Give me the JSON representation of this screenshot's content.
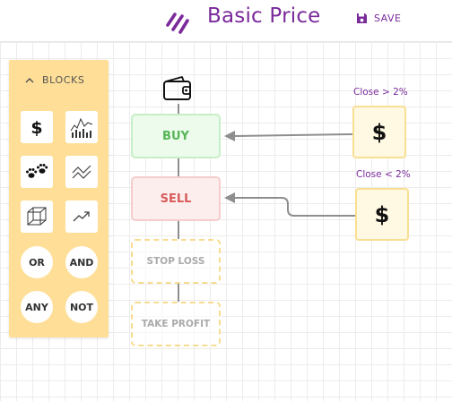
{
  "header": {
    "title": "Basic Price",
    "save_label": "SAVE"
  },
  "palette": {
    "toggle_label": "BLOCKS",
    "tiles": [
      {
        "icon": "dollar-icon"
      },
      {
        "icon": "candlestick-chart-icon"
      },
      {
        "icon": "paw-prints-icon"
      },
      {
        "icon": "zigzag-lines-icon"
      },
      {
        "icon": "cube-icon"
      },
      {
        "icon": "trend-up-icon"
      }
    ],
    "operators": [
      "OR",
      "AND",
      "ANY",
      "NOT"
    ]
  },
  "flow": {
    "start_icon": "wallet-icon",
    "nodes": [
      "BUY",
      "SELL",
      "STOP LOSS",
      "TAKE PROFIT"
    ]
  },
  "conditions": [
    {
      "label": "Close > 2%",
      "symbol": "$"
    },
    {
      "label": "Close < 2%",
      "symbol": "$"
    }
  ],
  "colors": {
    "brand": "#7a2a9a",
    "palette_bg": "#ffdf97",
    "buy": "#56b556",
    "sell": "#d85a5a"
  }
}
